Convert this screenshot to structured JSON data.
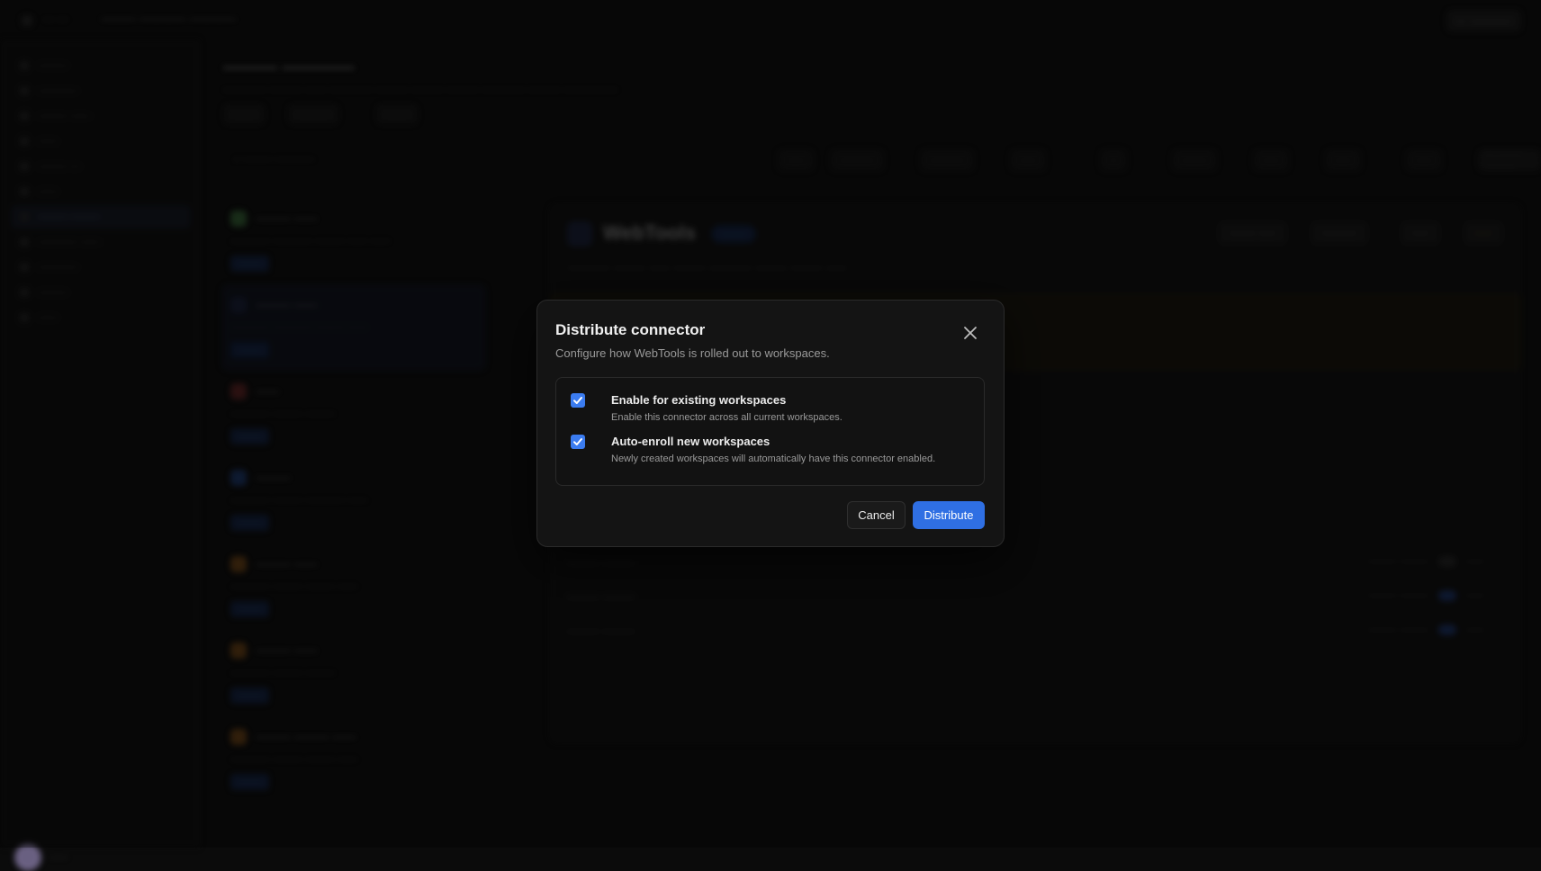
{
  "modal": {
    "title": "Distribute connector",
    "subtitle": "Configure how WebTools is rolled out to workspaces.",
    "options": [
      {
        "label": "Enable for existing workspaces",
        "description": "Enable this connector across all current workspaces.",
        "checked": true
      },
      {
        "label": "Auto-enroll new workspaces",
        "description": "Newly created workspaces will automatically have this connector enabled.",
        "checked": true
      }
    ],
    "cancel_label": "Cancel",
    "submit_label": "Distribute"
  },
  "colors": {
    "accent": "#2f6fe3",
    "checkbox": "#3b7cf0",
    "modal_bg": "#141414",
    "page_bg": "#0b0b0b"
  },
  "detail": {
    "title": "WebTools"
  }
}
